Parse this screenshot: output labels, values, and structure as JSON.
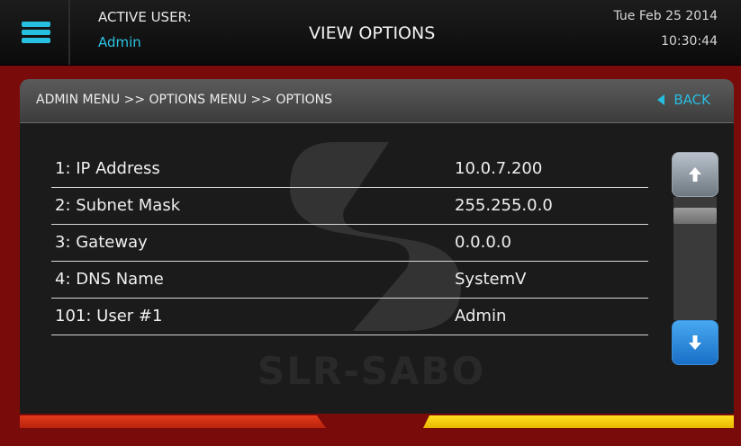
{
  "header": {
    "active_user_label": "ACTIVE USER:",
    "active_user_name": "Admin",
    "title": "VIEW OPTIONS",
    "date": "Tue Feb 25 2014",
    "time": "10:30:44"
  },
  "panel": {
    "breadcrumb": "ADMIN MENU >> OPTIONS MENU >> OPTIONS",
    "back_label": "BACK",
    "watermark_text": "SLR-SABO"
  },
  "options": [
    {
      "label": "1: IP Address",
      "value": "10.0.7.200"
    },
    {
      "label": "2: Subnet Mask",
      "value": "255.255.0.0"
    },
    {
      "label": "3: Gateway",
      "value": "0.0.0.0"
    },
    {
      "label": "4: DNS Name",
      "value": "SystemV"
    },
    {
      "label": "101: User #1",
      "value": "Admin"
    }
  ],
  "icons": {
    "menu": "hamburger-menu-icon",
    "back": "triangle-left-icon",
    "scroll_up": "arrow-up-icon",
    "scroll_down": "arrow-down-icon"
  },
  "colors": {
    "accent_cyan": "#28bde0",
    "background_red": "#7a0b0b",
    "accent_red": "#e23a1a",
    "accent_yellow": "#ffdf1e"
  }
}
